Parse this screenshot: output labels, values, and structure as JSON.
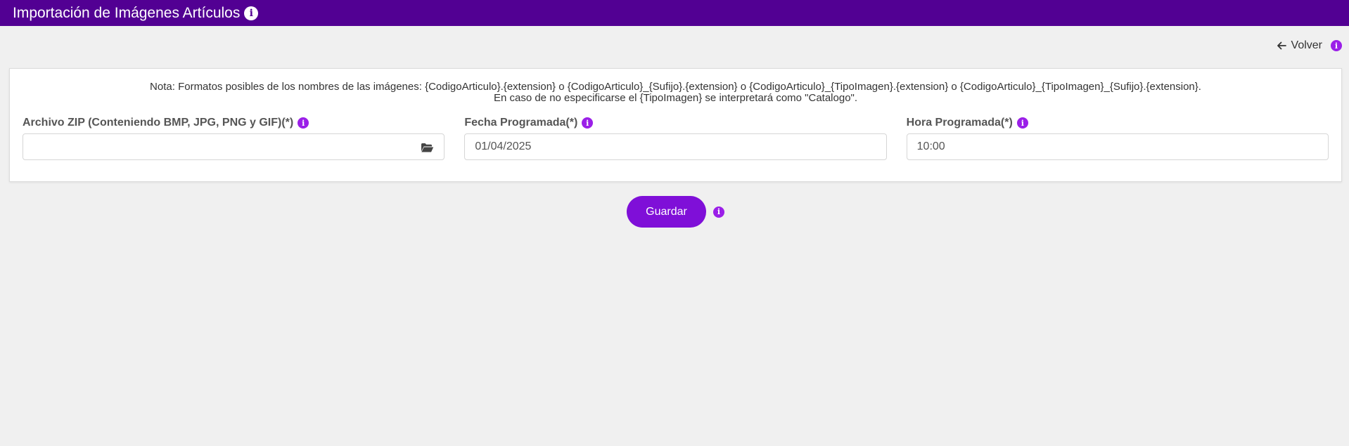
{
  "header": {
    "title": "Importación de Imágenes Artículos",
    "info_icon": "info-icon"
  },
  "nav": {
    "back_label": "Volver",
    "back_icon": "arrow-left-icon"
  },
  "note": {
    "line1": "Nota: Formatos posibles de los nombres de las imágenes: {CodigoArticulo}.{extension} o {CodigoArticulo}_{Sufijo}.{extension} o {CodigoArticulo}_{TipoImagen}.{extension} o {CodigoArticulo}_{TipoImagen}_{Sufijo}.{extension}.",
    "line2": "En caso de no especificarse el {TipoImagen} se interpretará como \"Catalogo\"."
  },
  "form": {
    "zip": {
      "label": "Archivo ZIP (Conteniendo BMP, JPG, PNG y GIF)(*)",
      "value": "",
      "icon": "folder-open-icon"
    },
    "date": {
      "label": "Fecha Programada(*)",
      "value": "01/04/2025"
    },
    "time": {
      "label": "Hora Programada(*)",
      "value": "10:00"
    }
  },
  "actions": {
    "save_label": "Guardar"
  },
  "colors": {
    "header_bg": "#520093",
    "accent": "#7f0fd8",
    "info_icon": "#9b1fe8",
    "page_bg": "#f0f0f0"
  }
}
